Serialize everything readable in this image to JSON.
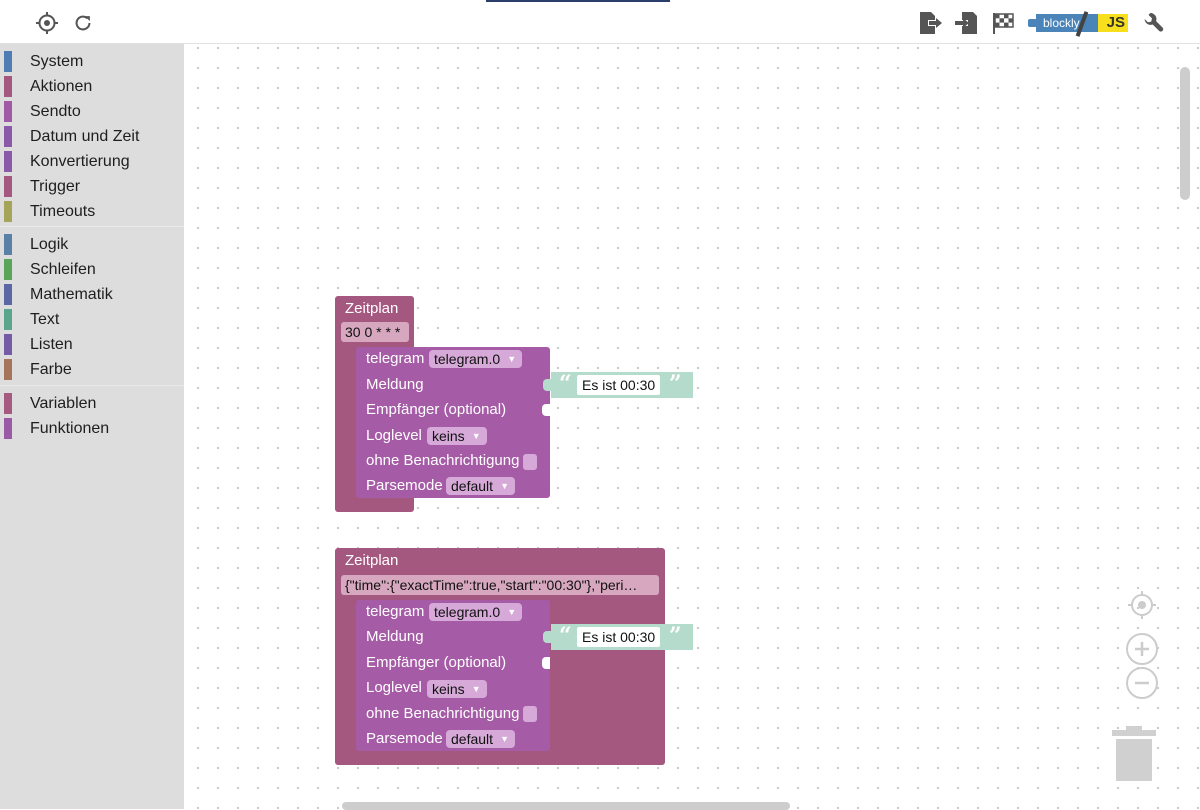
{
  "sidebar": {
    "categories": [
      {
        "label": "System",
        "color": "#4f7db3"
      },
      {
        "label": "Aktionen",
        "color": "#a5587f"
      },
      {
        "label": "Sendto",
        "color": "#a05aa6"
      },
      {
        "label": "Datum und Zeit",
        "color": "#8a59a8"
      },
      {
        "label": "Konvertierung",
        "color": "#8a59a8"
      },
      {
        "label": "Trigger",
        "color": "#a5587f"
      },
      {
        "label": "Timeouts",
        "color": "#a5a55a"
      },
      {
        "label": "Logik",
        "color": "#5b80a5"
      },
      {
        "label": "Schleifen",
        "color": "#5ba55b"
      },
      {
        "label": "Mathematik",
        "color": "#5b67a5"
      },
      {
        "label": "Text",
        "color": "#5ba58c"
      },
      {
        "label": "Listen",
        "color": "#745ba5"
      },
      {
        "label": "Farbe",
        "color": "#a5745b"
      },
      {
        "label": "Variablen",
        "color": "#a55b80"
      },
      {
        "label": "Funktionen",
        "color": "#995ba5"
      }
    ]
  },
  "toolbar": {
    "left_icons": [
      "target-icon",
      "refresh-icon"
    ],
    "right_icons": [
      "export-icon",
      "import-icon",
      "checkered-flag-icon",
      "blockly-js-toggle",
      "wrench-icon"
    ],
    "blockly_label": "blockly",
    "js_label": "JS"
  },
  "blocks": [
    {
      "title": "Zeitplan",
      "schedule": "30 0 * * *",
      "telegram": {
        "label": "telegram",
        "instance": "telegram.0",
        "message_label": "Meldung",
        "message_text": "Es ist 00:30",
        "recipient_label": "Empfänger (optional)",
        "loglevel_label": "Loglevel",
        "loglevel_value": "keins",
        "silent_label": "ohne Benachrichtigung",
        "parsemode_label": "Parsemode",
        "parsemode_value": "default"
      }
    },
    {
      "title": "Zeitplan",
      "schedule": "{\"time\":{\"exactTime\":true,\"start\":\"00:30\"},\"peri…",
      "telegram": {
        "label": "telegram",
        "instance": "telegram.0",
        "message_label": "Meldung",
        "message_text": "Es ist 00:30",
        "recipient_label": "Empfänger (optional)",
        "loglevel_label": "Loglevel",
        "loglevel_value": "keins",
        "silent_label": "ohne Benachrichtigung",
        "parsemode_label": "Parsemode",
        "parsemode_value": "default"
      }
    }
  ],
  "workspace_controls": [
    "center-icon",
    "zoom-in-icon",
    "zoom-out-icon",
    "trash-icon"
  ],
  "colors": {
    "schedule_block": "#a5587f",
    "telegram_block": "#a55ba6",
    "text_block": "#b4dbcc",
    "sidebar_bg": "#dddddd"
  }
}
